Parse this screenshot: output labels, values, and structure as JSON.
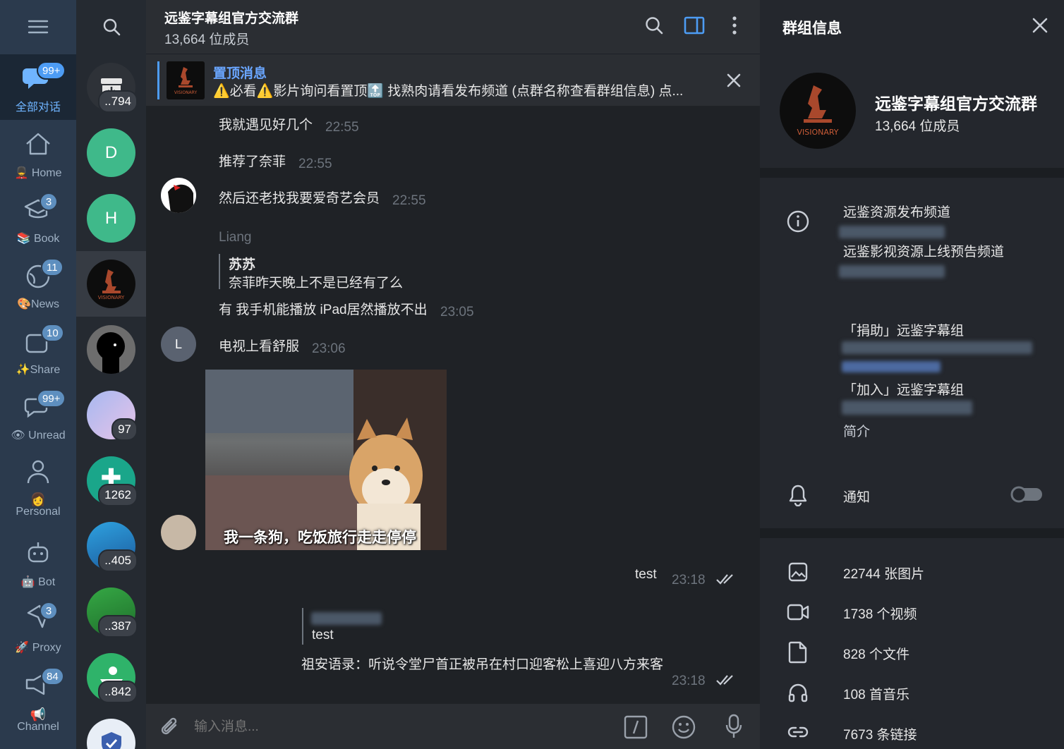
{
  "folders": [
    {
      "label": "全部对话",
      "badge": "99+",
      "icon": "chats-icon"
    },
    {
      "label": "Home",
      "badge": "",
      "icon": "home-icon",
      "emoji": "💂"
    },
    {
      "label": "Book",
      "badge": "3",
      "icon": "book-icon",
      "emoji": "📚"
    },
    {
      "label": "News",
      "badge": "11",
      "icon": "news-icon",
      "emoji": "🎨"
    },
    {
      "label": "Share",
      "badge": "10",
      "icon": "share-icon",
      "emoji": "✨"
    },
    {
      "label": "Unread",
      "badge": "99+",
      "icon": "unread-icon",
      "emoji": "👁"
    },
    {
      "label": "Personal",
      "badge": "",
      "icon": "person-icon",
      "emoji": "👩"
    },
    {
      "label": "Bot",
      "badge": "",
      "icon": "bot-icon",
      "emoji": "🤖"
    },
    {
      "label": "Proxy",
      "badge": "3",
      "icon": "proxy-icon",
      "emoji": "🚀"
    },
    {
      "label": "Channel",
      "badge": "84",
      "icon": "channel-icon",
      "emoji": "📢"
    }
  ],
  "chats": [
    {
      "letter": "",
      "badge": "..794",
      "color": "#2e3238"
    },
    {
      "letter": "D",
      "badge": "",
      "color": "#3fb98a"
    },
    {
      "letter": "H",
      "badge": "",
      "color": "#3fb98a"
    },
    {
      "letter": "",
      "badge": "",
      "color": "#111111"
    },
    {
      "letter": "",
      "badge": "",
      "color": "#6d6d6d"
    },
    {
      "letter": "",
      "badge": "97",
      "color": "#8e8bd6"
    },
    {
      "letter": "✚",
      "badge": "1262",
      "color": "#1aa68a"
    },
    {
      "letter": "",
      "badge": "..405",
      "color": "#2ea2e0"
    },
    {
      "letter": "",
      "badge": "..387",
      "color": "#35a845"
    },
    {
      "letter": "",
      "badge": "..842",
      "color": "#2fb36a"
    },
    {
      "letter": "",
      "badge": "",
      "color": "#e8eef6"
    }
  ],
  "header": {
    "title": "远鉴字幕组官方交流群",
    "members": "13,664 位成员"
  },
  "pinned": {
    "title": "置顶消息",
    "text": "⚠️必看⚠️影片询问看置顶🔝 找熟肉请看发布频道 (点群名称查看群组信息) 点..."
  },
  "messages": [
    {
      "text": "我就遇见好几个",
      "time": "22:55"
    },
    {
      "text": "推荐了奈菲",
      "time": "22:55"
    },
    {
      "text": "然后还老找我要爱奇艺会员",
      "time": "22:55"
    },
    {
      "sender": "Liang",
      "reply_name": "苏苏",
      "reply_text": "奈菲昨天晚上不是已经有了么",
      "text": "有 我手机能播放 iPad居然播放不出",
      "time": "23:05"
    },
    {
      "avatar": "L",
      "text": "电视上看舒服",
      "time": "23:06"
    },
    {
      "caption": "我一条狗，吃饭旅行走走停停"
    },
    {
      "text": "test",
      "time": "23:18"
    },
    {
      "reply_text": "test",
      "text": "祖安语录：听说令堂尸首正被吊在村口迎客松上喜迎八方来客",
      "time": "23:18"
    }
  ],
  "composer": {
    "placeholder": "输入消息..."
  },
  "info": {
    "panel_title": "群组信息",
    "name": "远鉴字幕组官方交流群",
    "members": "13,664 位成员",
    "links": [
      "远鉴资源发布频道",
      "远鉴影视资源上线预告频道",
      "「捐助」远鉴字幕组",
      "「加入」远鉴字幕组",
      "简介"
    ],
    "notify_label": "通知",
    "notify_on": false,
    "media": [
      {
        "label": "22744 张图片",
        "icon": "photo-icon"
      },
      {
        "label": "1738 个视频",
        "icon": "video-icon"
      },
      {
        "label": "828 个文件",
        "icon": "file-icon"
      },
      {
        "label": "108 首音乐",
        "icon": "music-icon"
      },
      {
        "label": "7673 条链接",
        "icon": "link-icon"
      }
    ]
  },
  "colors": {
    "accent": "#4d9cf4",
    "link": "#6aa6ff",
    "panel": "#24272d"
  }
}
